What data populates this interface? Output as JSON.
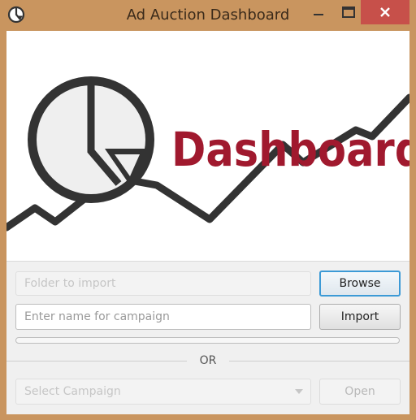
{
  "window": {
    "title": "Ad Auction Dashboard"
  },
  "banner": {
    "logo_text": "Dashboard"
  },
  "import": {
    "folder_placeholder": "Folder to import",
    "browse_label": "Browse",
    "campaign_placeholder": "Enter name for campaign",
    "import_label": "Import",
    "progress": 0
  },
  "divider": {
    "label": "OR"
  },
  "open": {
    "select_placeholder": "Select Campaign",
    "open_label": "Open"
  },
  "colors": {
    "logo_red": "#a0192e",
    "graph_dark": "#333333",
    "focus_blue": "#3c9ad6"
  }
}
